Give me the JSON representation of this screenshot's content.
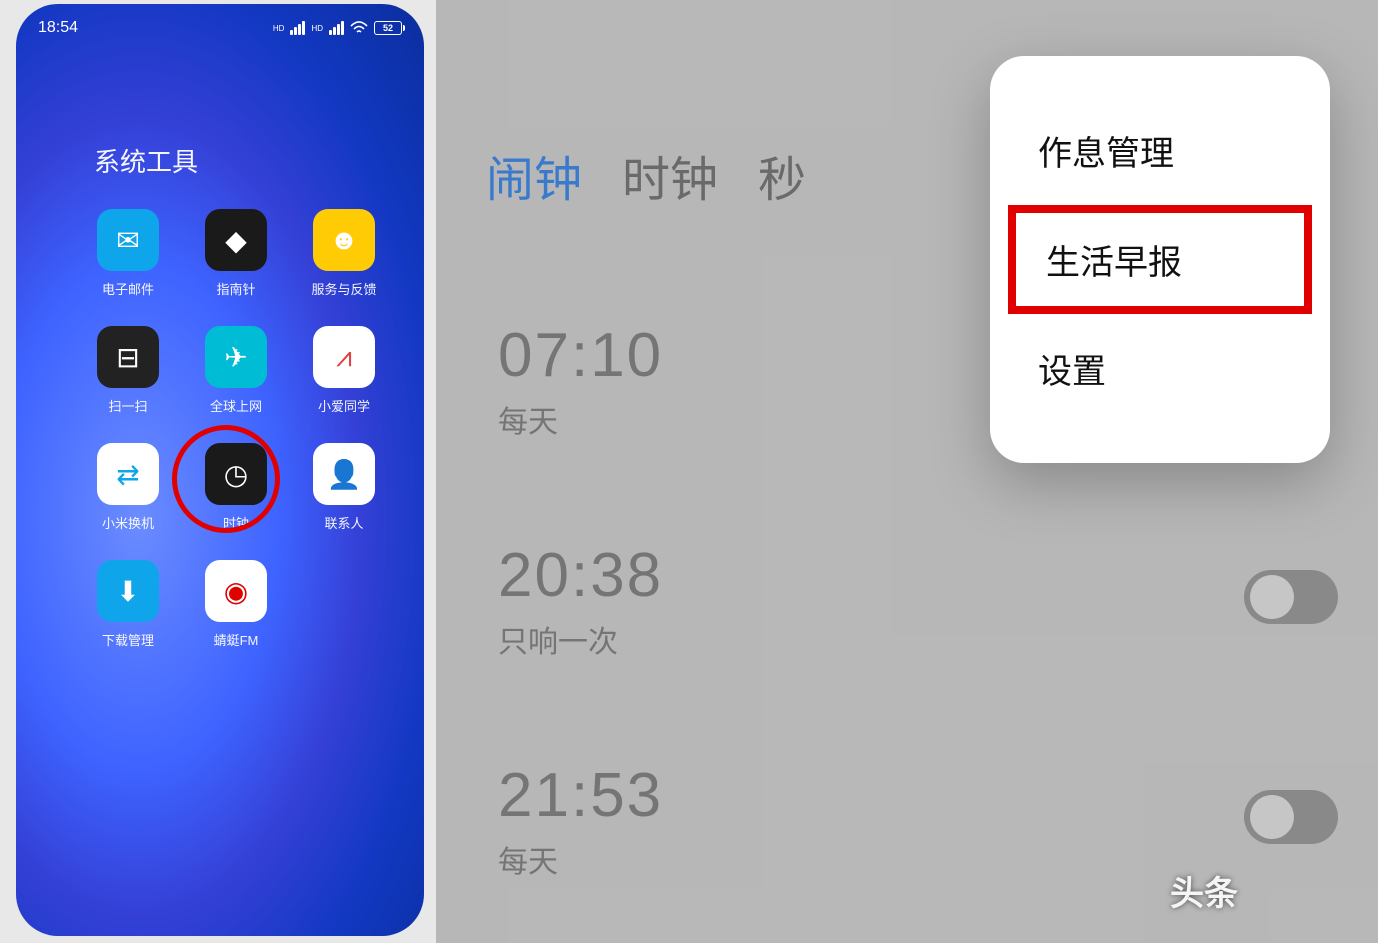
{
  "statusbar": {
    "time": "18:54",
    "hd1": "HD",
    "hd2": "HD",
    "battery": "52"
  },
  "folder": {
    "title": "系统工具"
  },
  "apps": [
    {
      "id": "mail",
      "label": "电子邮件",
      "icon": "✉",
      "bg": "bg-blue"
    },
    {
      "id": "compass",
      "label": "指南针",
      "icon": "◆",
      "bg": "bg-dark"
    },
    {
      "id": "feedback",
      "label": "服务与反馈",
      "icon": "☻",
      "bg": "bg-yellow"
    },
    {
      "id": "scan",
      "label": "扫一扫",
      "icon": "⊟",
      "bg": "bg-darkgray"
    },
    {
      "id": "roaming",
      "label": "全球上网",
      "icon": "✈",
      "bg": "bg-teal"
    },
    {
      "id": "xiaoai",
      "label": "小爱同学",
      "icon": "⩘",
      "bg": "bg-white"
    },
    {
      "id": "mimover",
      "label": "小米换机",
      "icon": "⇄",
      "bg": "bg-white"
    },
    {
      "id": "clock",
      "label": "时钟",
      "icon": "◷",
      "bg": "bg-dark",
      "highlight": true
    },
    {
      "id": "contacts",
      "label": "联系人",
      "icon": "👤",
      "bg": "bg-white"
    },
    {
      "id": "download",
      "label": "下载管理",
      "icon": "⬇",
      "bg": "bg-blue"
    },
    {
      "id": "qingting",
      "label": "蜻蜓FM",
      "icon": "◉",
      "bg": "bg-white"
    }
  ],
  "clock": {
    "tabs": [
      "闹钟",
      "时钟",
      "秒"
    ],
    "alarms": [
      {
        "time": "07:10",
        "repeat": "每天",
        "toggle": false
      },
      {
        "time": "20:38",
        "repeat": "只响一次",
        "toggle": false
      },
      {
        "time": "21:53",
        "repeat": "每天",
        "toggle": false
      }
    ],
    "menu": {
      "item1": "作息管理",
      "item2": "生活早报",
      "item3": "设置"
    },
    "watermark": "头条"
  }
}
